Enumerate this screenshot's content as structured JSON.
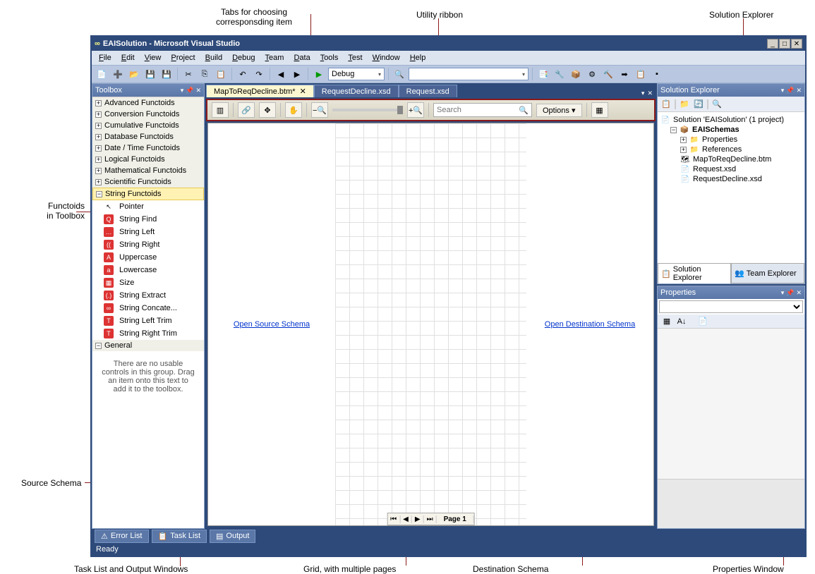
{
  "title": "EAISolution - Microsoft Visual Studio",
  "menus": [
    "File",
    "Edit",
    "View",
    "Project",
    "Build",
    "Debug",
    "Team",
    "Data",
    "Tools",
    "Test",
    "Window",
    "Help"
  ],
  "toolbar": {
    "config_dropdown": "Debug",
    "search_dropdown": ""
  },
  "toolbox": {
    "header": "Toolbox",
    "groups": [
      "Advanced Functoids",
      "Conversion Functoids",
      "Cumulative Functoids",
      "Database Functoids",
      "Date / Time Functoids",
      "Logical Functoids",
      "Mathematical Functoids",
      "Scientific Functoids"
    ],
    "open_group": "String Functoids",
    "items": [
      {
        "label": "Pointer",
        "icon": "pointer",
        "bg": "#fff",
        "fg": "#000"
      },
      {
        "label": "String Find",
        "icon": "Q",
        "bg": "#d33",
        "fg": "#fff"
      },
      {
        "label": "String Left",
        "icon": "…",
        "bg": "#d33",
        "fg": "#fff"
      },
      {
        "label": "String Right",
        "icon": "((",
        "bg": "#d33",
        "fg": "#fff"
      },
      {
        "label": "Uppercase",
        "icon": "A",
        "bg": "#d33",
        "fg": "#fff"
      },
      {
        "label": "Lowercase",
        "icon": "a",
        "bg": "#d33",
        "fg": "#fff"
      },
      {
        "label": "Size",
        "icon": "▦",
        "bg": "#d33",
        "fg": "#fff"
      },
      {
        "label": "String Extract",
        "icon": "(.)",
        "bg": "#d33",
        "fg": "#fff"
      },
      {
        "label": "String Concate...",
        "icon": "∞",
        "bg": "#d33",
        "fg": "#fff"
      },
      {
        "label": "String Left Trim",
        "icon": "T",
        "bg": "#d33",
        "fg": "#fff"
      },
      {
        "label": "String Right Trim",
        "icon": "T",
        "bg": "#d33",
        "fg": "#fff"
      }
    ],
    "general_header": "General",
    "general_text": "There are no usable controls in this group. Drag an item onto this text to add it to the toolbox."
  },
  "doc_tabs": [
    {
      "label": "MapToReqDecline.btm*",
      "active": true,
      "closable": true
    },
    {
      "label": "RequestDecline.xsd",
      "active": false,
      "closable": false
    },
    {
      "label": "Request.xsd",
      "active": false,
      "closable": false
    }
  ],
  "ribbon": {
    "search_placeholder": "Search",
    "options_label": "Options"
  },
  "mapper": {
    "open_source": "Open Source Schema",
    "open_dest": "Open Destination Schema",
    "page_label": "Page 1"
  },
  "solution_explorer": {
    "header": "Solution Explorer",
    "root": "Solution 'EAISolution' (1 project)",
    "project": "EAISchemas",
    "nodes": [
      "Properties",
      "References"
    ],
    "files": [
      "MapToReqDecline.btm",
      "Request.xsd",
      "RequestDecline.xsd"
    ],
    "tabs": [
      "Solution Explorer",
      "Team Explorer"
    ]
  },
  "properties": {
    "header": "Properties"
  },
  "bottom_tabs": [
    "Error List",
    "Task List",
    "Output"
  ],
  "status": "Ready",
  "annotations": {
    "tabs": "Tabs for choosing\ncorresponsding item",
    "ribbon": "Utility ribbon",
    "solexplorer": "Solution Explorer",
    "functoids": "Functoids\nin Toolbox",
    "source": "Source Schema",
    "tasklist": "Task List and Output Windows",
    "grid": "Grid, with multiple pages",
    "dest": "Destination Schema",
    "props": "Properties Window"
  }
}
